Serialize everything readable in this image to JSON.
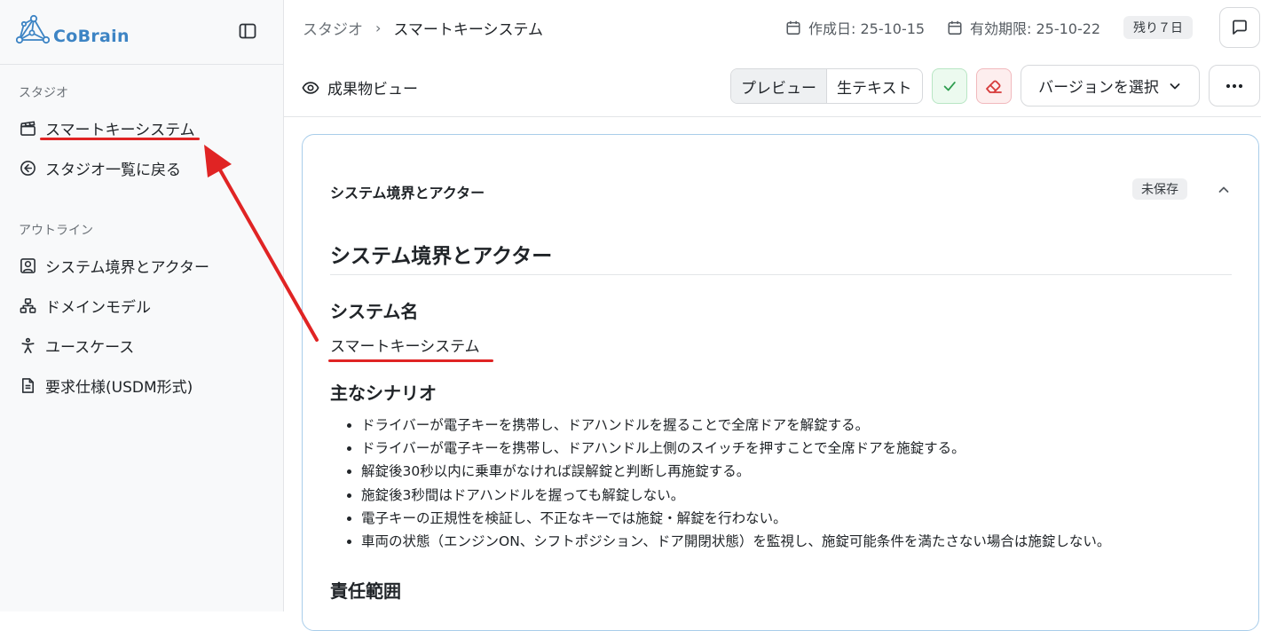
{
  "brand": {
    "name": "CoBrain"
  },
  "sidebar": {
    "studio_label": "スタジオ",
    "studio_items": [
      {
        "label": "スマートキーシステム",
        "icon": "clapperboard-icon"
      },
      {
        "label": "スタジオ一覧に戻る",
        "icon": "arrow-left-circle-icon"
      }
    ],
    "outline_label": "アウトライン",
    "outline_items": [
      {
        "label": "システム境界とアクター",
        "icon": "user-square-icon"
      },
      {
        "label": "ドメインモデル",
        "icon": "network-icon"
      },
      {
        "label": "ユースケース",
        "icon": "person-icon"
      },
      {
        "label": "要求仕様(USDM形式)",
        "icon": "file-text-icon"
      }
    ]
  },
  "header": {
    "breadcrumb_root": "スタジオ",
    "breadcrumb_separator": "›",
    "breadcrumb_current": "スマートキーシステム",
    "created": "作成日: 25-10-15",
    "expires": "有効期限: 25-10-22",
    "remaining": "残り７日"
  },
  "toolbar": {
    "view_title": "成果物ビュー",
    "tab_preview": "プレビュー",
    "tab_raw": "生テキスト",
    "version_select": "バージョンを選択"
  },
  "card": {
    "section_title": "システム境界とアクター",
    "status_badge": "未保存",
    "doc": {
      "h1": "システム境界とアクター",
      "system_name_heading": "システム名",
      "system_name": "スマートキーシステム",
      "scenarios_heading": "主なシナリオ",
      "scenarios": [
        "ドライバーが電子キーを携帯し、ドアハンドルを握ることで全席ドアを解錠する。",
        "ドライバーが電子キーを携帯し、ドアハンドル上側のスイッチを押すことで全席ドアを施錠する。",
        "解錠後30秒以内に乗車がなければ誤解錠と判断し再施錠する。",
        "施錠後3秒間はドアハンドルを握っても解錠しない。",
        "電子キーの正規性を検証し、不正なキーでは施錠・解錠を行わない。",
        "車両の状態（エンジンON、シフトポジション、ドア開閉状態）を監視し、施錠可能条件を満たさない場合は施錠しない。"
      ],
      "responsibility_heading": "責任範囲"
    }
  },
  "colors": {
    "brand_blue": "#3d84c4",
    "annotation_red": "#e02424",
    "card_border": "#a9cdea",
    "confirm_green": "#2e9d4f"
  }
}
